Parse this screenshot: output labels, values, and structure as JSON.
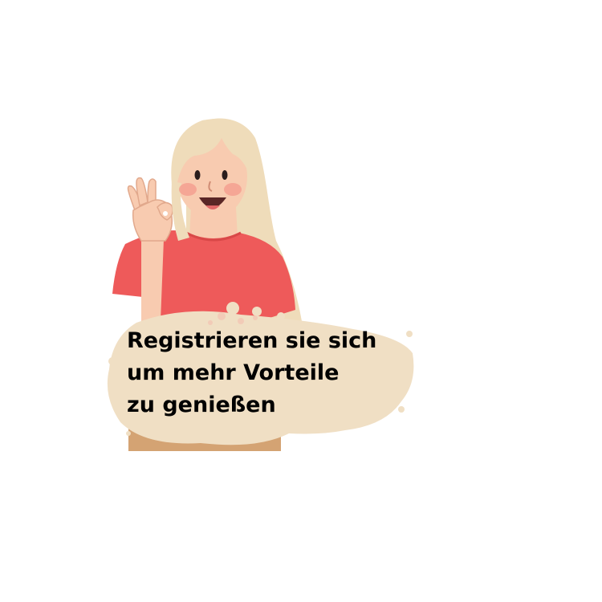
{
  "caption": {
    "lines": [
      "Registrieren sie sich",
      "um mehr Vorteile",
      "zu genießen"
    ]
  },
  "colors": {
    "background": "#ffffff",
    "hair": "#efdcba",
    "skin": "#f8cbb0",
    "shirt": "#ee5a5a",
    "cheek": "#f4a090",
    "pants": "#d4a373",
    "paint_splash": "#f0dfc4",
    "text": "#000000"
  }
}
